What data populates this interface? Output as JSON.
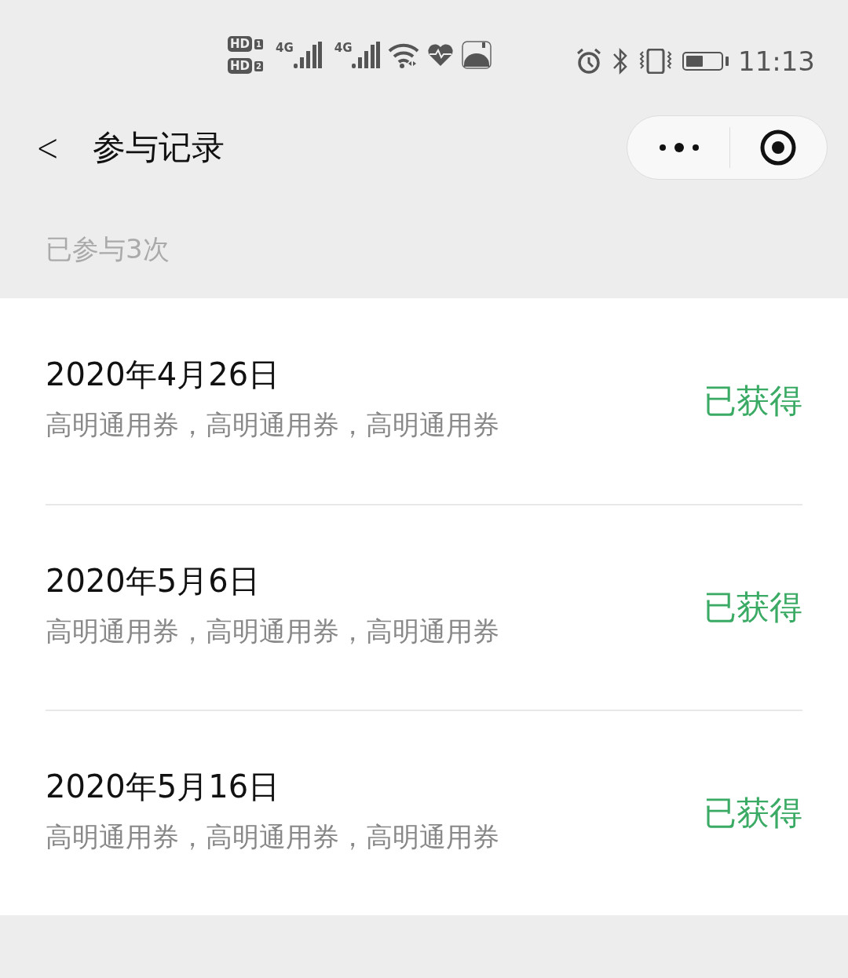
{
  "status_bar": {
    "sim_badges": [
      {
        "label": "HD",
        "slot": "1"
      },
      {
        "label": "HD",
        "slot": "2"
      }
    ],
    "networks": [
      "4G",
      "4G"
    ],
    "time": "11:13"
  },
  "nav": {
    "back": "<",
    "title": "参与记录"
  },
  "summary": "已参与3次",
  "records": [
    {
      "date": "2020年4月26日",
      "prizes": "高明通用券，高明通用券，高明通用券",
      "status": "已获得"
    },
    {
      "date": "2020年5月6日",
      "prizes": "高明通用券，高明通用券，高明通用券",
      "status": "已获得"
    },
    {
      "date": "2020年5月16日",
      "prizes": "高明通用券，高明通用券，高明通用券",
      "status": "已获得"
    }
  ]
}
